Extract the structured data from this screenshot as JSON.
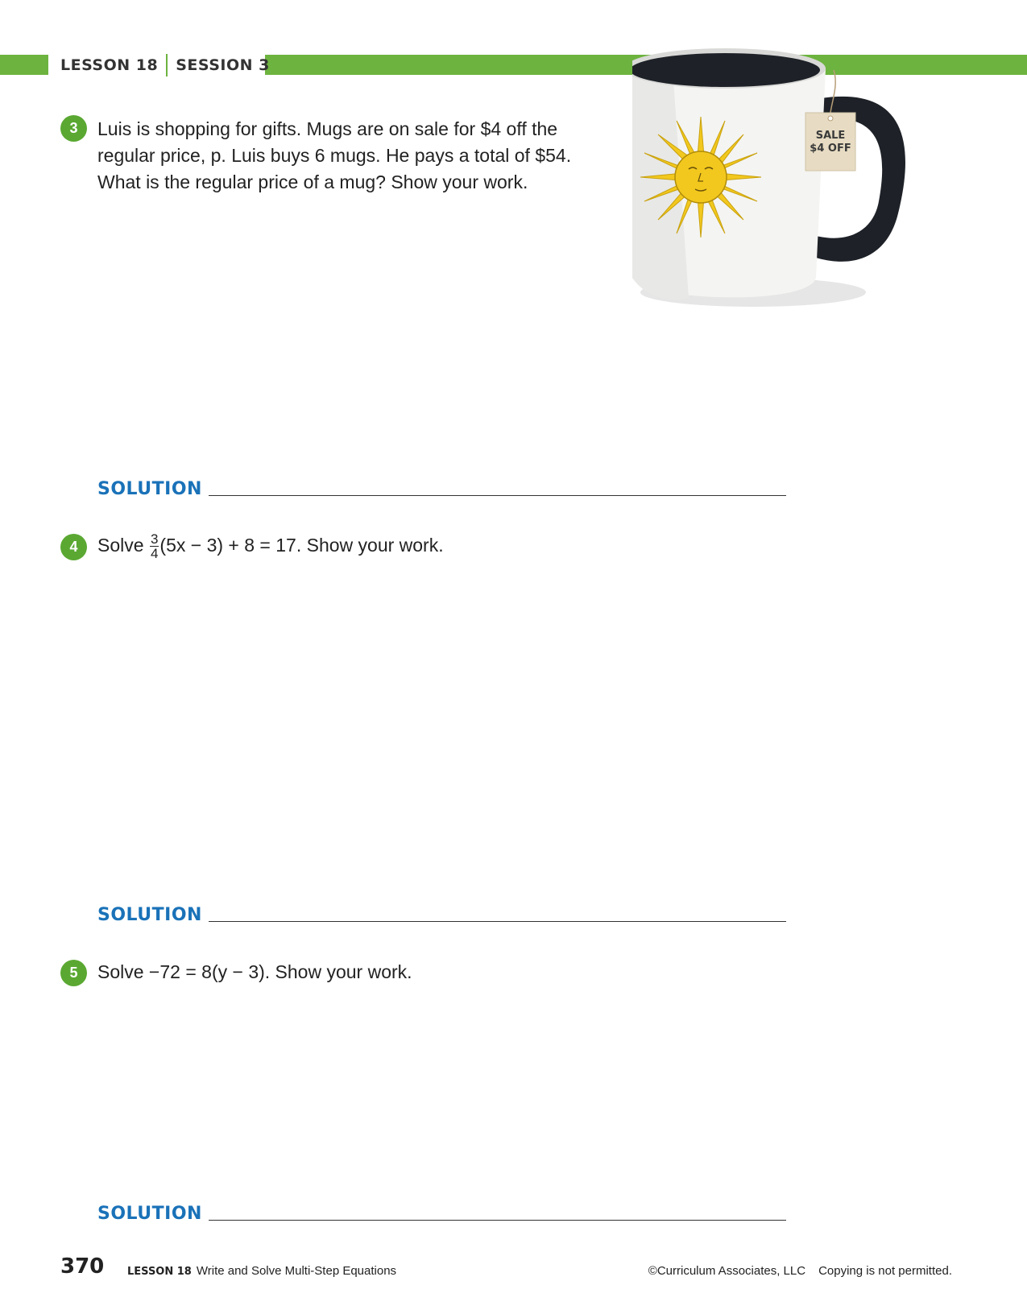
{
  "header": {
    "lesson": "LESSON 18",
    "session": "SESSION 3"
  },
  "mug": {
    "tag_line1": "SALE",
    "tag_line2": "$4 OFF"
  },
  "questions": [
    {
      "number": "3",
      "text": "Luis is shopping for gifts. Mugs are on sale for $4 off the regular price, p. Luis buys 6 mugs. He pays a total of $54. What is the regular price of a mug? Show your work.",
      "solution_label": "SOLUTION"
    },
    {
      "number": "4",
      "prefix": "Solve",
      "frac_num": "3",
      "frac_den": "4",
      "equation_rest": "(5x − 3) + 8 = 17. Show your work.",
      "solution_label": "SOLUTION"
    },
    {
      "number": "5",
      "text": "Solve −72 = 8(y − 3). Show your work.",
      "solution_label": "SOLUTION"
    }
  ],
  "footer": {
    "page_number": "370",
    "lesson": "LESSON 18",
    "lesson_title": "Write and Solve Multi-Step Equations",
    "copyright": "©Curriculum Associates, LLC",
    "notice": "Copying is not permitted."
  },
  "colors": {
    "accent_green": "#6db33f",
    "solution_blue": "#1a72b8",
    "sun_yellow": "#f2c81e",
    "mug_black": "#1e2228"
  }
}
